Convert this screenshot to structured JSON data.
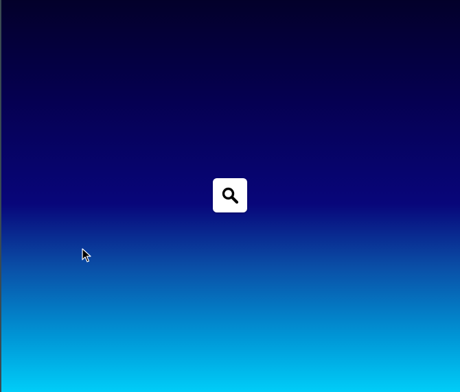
{
  "screen": {
    "background_gradient": [
      "#03002a",
      "#050050",
      "#08067a",
      "#0a4ea6",
      "#0096d6",
      "#00cdf8"
    ]
  },
  "search_button": {
    "icon": "search-icon",
    "background": "#ffffff",
    "icon_color": "#000000"
  },
  "pointer": {
    "icon": "mouse-cursor-icon"
  }
}
